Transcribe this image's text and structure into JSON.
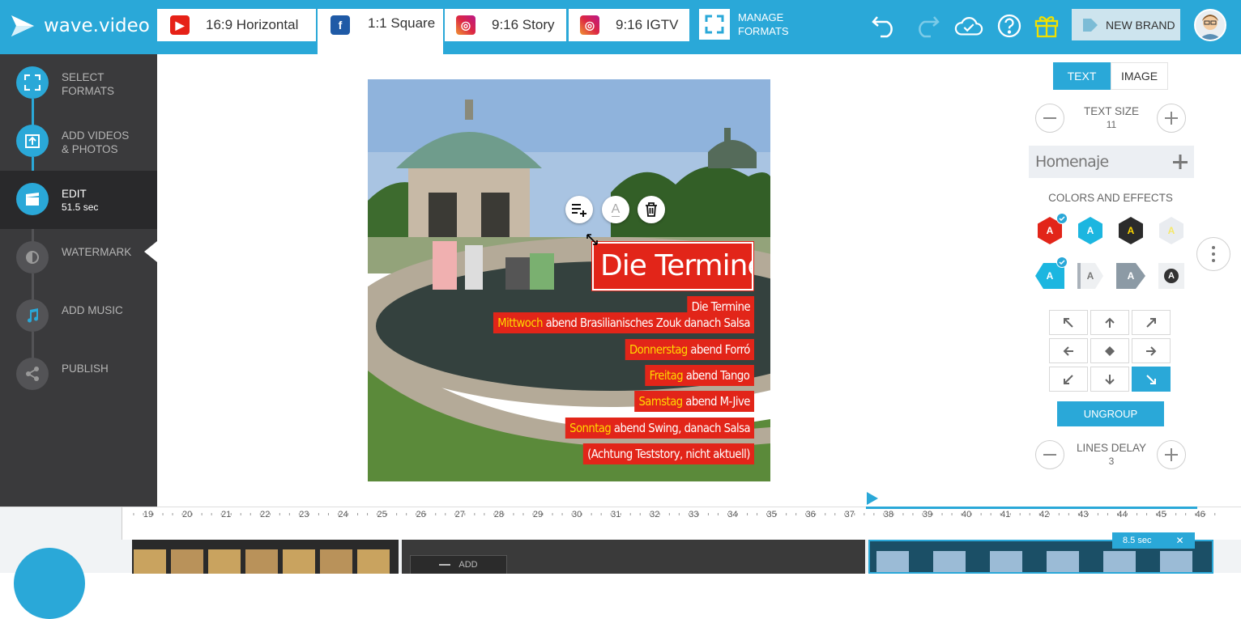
{
  "app": {
    "logo_text": "wave.video"
  },
  "format_tabs": [
    {
      "label": "16:9 Horizontal",
      "icon": "youtube-icon",
      "color": "#e62117"
    },
    {
      "label": "1:1 Square",
      "icon": "facebook-icon",
      "color": "#1f5aa6"
    },
    {
      "label": "9:16 Story",
      "icon": "instagram-icon",
      "color": "#c13584"
    },
    {
      "label": "9:16 IGTV",
      "icon": "instagram-icon",
      "color": "#c13584"
    }
  ],
  "manage_formats": {
    "line1": "MANAGE",
    "line2": "FORMATS"
  },
  "toolbar": {
    "new_brand_label": "NEW BRAND"
  },
  "steps": [
    {
      "line1": "SELECT",
      "line2": "FORMATS"
    },
    {
      "line1": "ADD VIDEOS",
      "line2": "& PHOTOS"
    },
    {
      "line1": "EDIT",
      "line2": "51.5 sec"
    },
    {
      "line1": "WATERMARK",
      "line2": ""
    },
    {
      "line1": "ADD MUSIC",
      "line2": ""
    },
    {
      "line1": "PUBLISH",
      "line2": ""
    }
  ],
  "canvas": {
    "title": "Die Termine",
    "lines": [
      {
        "hl": "",
        "rest": "Die Termine"
      },
      {
        "hl": "Mittwoch",
        "rest": " abend Brasilianisches Zouk danach Salsa"
      },
      {
        "hl": "Donnerstag",
        "rest": " abend Forró"
      },
      {
        "hl": "Freitag",
        "rest": " abend Tango"
      },
      {
        "hl": "Samstag",
        "rest": " abend M-Jive"
      },
      {
        "hl": "Sonntag",
        "rest": " abend Swing, danach Salsa"
      },
      {
        "hl": "",
        "rest": "(Achtung Teststory, nicht aktuell)"
      }
    ]
  },
  "panel": {
    "tabs": [
      "TEXT",
      "IMAGE"
    ],
    "text_size_label": "TEXT SIZE",
    "text_size_value": "11",
    "font_name": "Homenaje",
    "colors_label": "COLORS AND EFFECTS",
    "swatch_letter": "A",
    "ungroup_label": "UNGROUP",
    "lines_delay_label": "LINES DELAY",
    "lines_delay_value": "3",
    "colors": {
      "red": "#e22519",
      "cyan": "#1cb6e0",
      "dark": "#2b2b2b",
      "light": "#e9ecf0",
      "accent": "#2aa8d8",
      "yellow": "#ffd800"
    }
  },
  "timeline": {
    "ticks": [
      "19",
      "20",
      "21",
      "22",
      "23",
      "24",
      "25",
      "26",
      "27",
      "28",
      "29",
      "30",
      "31",
      "32",
      "33",
      "34",
      "35",
      "36",
      "37",
      "38",
      "39",
      "40",
      "41",
      "42",
      "43",
      "44",
      "45",
      "46"
    ],
    "add_label": "ADD",
    "clip_duration": "8.5 sec"
  }
}
